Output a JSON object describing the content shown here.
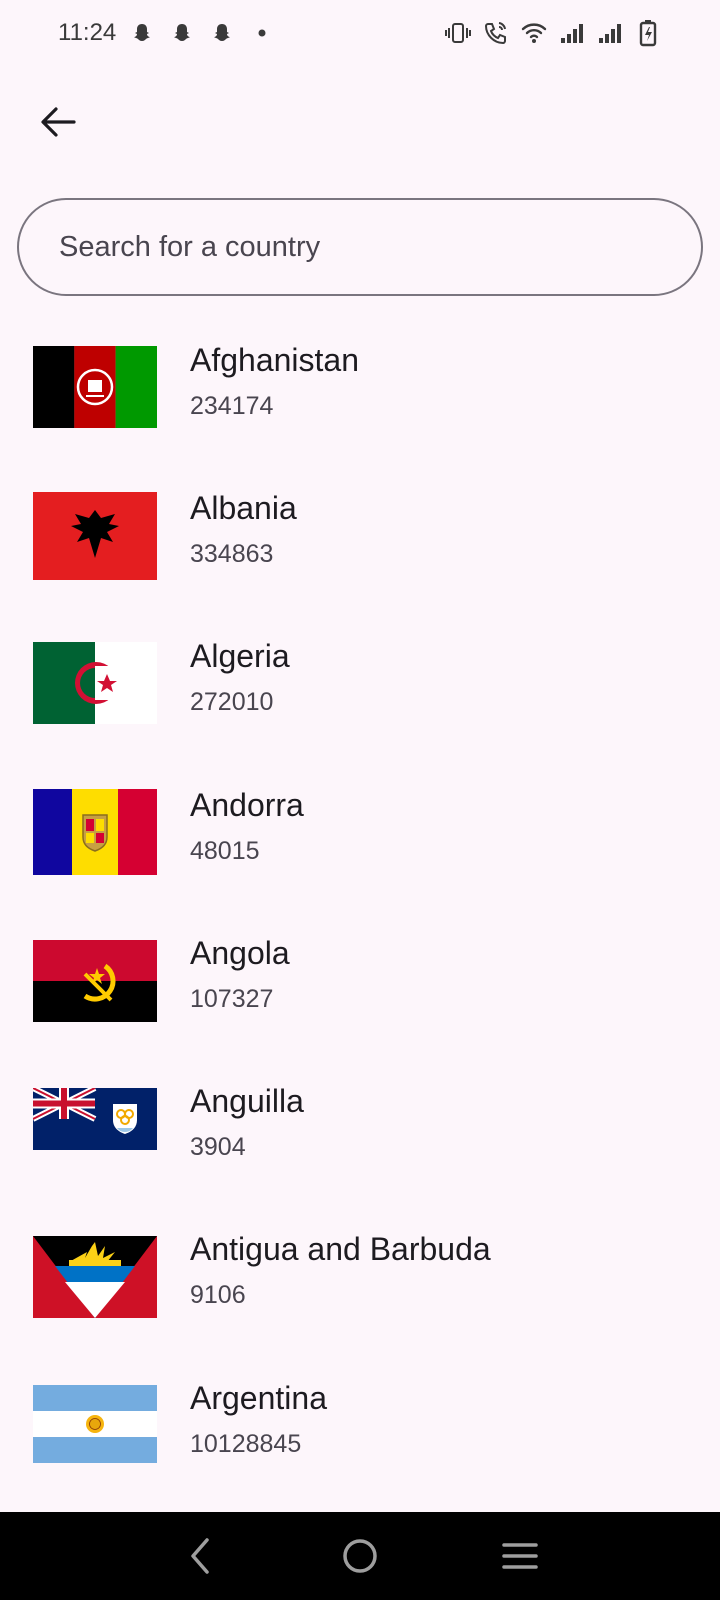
{
  "status_bar": {
    "time": "11:24",
    "left_icons": [
      "snapchat-icon",
      "snapchat-icon",
      "snapchat-icon",
      "dot-icon"
    ],
    "right_icons": [
      "vibrate-icon",
      "wifi-call-icon",
      "wifi-icon",
      "signal-icon",
      "signal-icon",
      "battery-charging-icon"
    ]
  },
  "header": {
    "back_icon": "arrow-back-icon"
  },
  "search": {
    "placeholder": "Search for a country",
    "value": ""
  },
  "countries": [
    {
      "name": "Afghanistan",
      "value": "234174",
      "flag": "afghanistan-flag"
    },
    {
      "name": "Albania",
      "value": "334863",
      "flag": "albania-flag"
    },
    {
      "name": "Algeria",
      "value": "272010",
      "flag": "algeria-flag"
    },
    {
      "name": "Andorra",
      "value": "48015",
      "flag": "andorra-flag"
    },
    {
      "name": "Angola",
      "value": "107327",
      "flag": "angola-flag"
    },
    {
      "name": "Anguilla",
      "value": "3904",
      "flag": "anguilla-flag"
    },
    {
      "name": "Antigua and Barbuda",
      "value": "9106",
      "flag": "antigua-and-barbuda-flag"
    },
    {
      "name": "Argentina",
      "value": "10128845",
      "flag": "argentina-flag"
    }
  ],
  "nav_bar": {
    "icons": [
      "nav-back-icon",
      "nav-home-icon",
      "nav-recents-icon"
    ]
  },
  "colors": {
    "background": "#fdf6fb",
    "text": "#1d1b20",
    "secondary_text": "#49454f",
    "outline": "#7a757f",
    "nav_bar": "#000000"
  }
}
